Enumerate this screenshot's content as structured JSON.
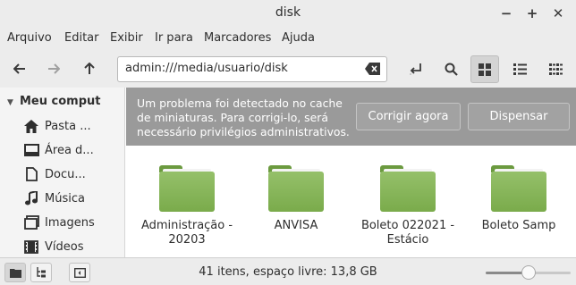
{
  "window": {
    "title": "disk"
  },
  "menubar": [
    "Arquivo",
    "Editar",
    "Exibir",
    "Ir para",
    "Marcadores",
    "Ajuda"
  ],
  "toolbar": {
    "path": "admin:///media/usuario/disk",
    "icons": [
      "back-arrow-icon",
      "forward-arrow-icon",
      "up-arrow-icon",
      "clear-location-icon",
      "toggle-location-icon",
      "search-icon",
      "icon-view-icon",
      "list-view-icon",
      "compact-view-icon"
    ],
    "active_view": "icon-view"
  },
  "sidebar": {
    "header": "Meu comput",
    "items": [
      {
        "label": "Pasta ...",
        "icon": "home-icon"
      },
      {
        "label": "Área d...",
        "icon": "desktop-icon"
      },
      {
        "label": "Docu...",
        "icon": "documents-icon"
      },
      {
        "label": "Música",
        "icon": "music-icon"
      },
      {
        "label": "Imagens",
        "icon": "pictures-icon"
      },
      {
        "label": "Vídeos",
        "icon": "videos-icon"
      }
    ]
  },
  "infobar": {
    "message": "Um problema foi detectado no cache de miniaturas. Para corrigi-lo, será necessário privilégios administrativos.",
    "fix_button": "Corrigir agora",
    "dismiss_button": "Dispensar"
  },
  "files": [
    {
      "name": "Administração - 20203",
      "icon": "folder-icon"
    },
    {
      "name": "ANVISA",
      "icon": "folder-icon"
    },
    {
      "name": "Boleto 022021 - Estácio",
      "icon": "folder-icon"
    },
    {
      "name": "Boleto Samp",
      "icon": "folder-icon"
    }
  ],
  "statusbar": {
    "text": "41 itens, espaço livre: 13,8 GB",
    "zoom_level": 0.5
  },
  "colors": {
    "folder": "#7aab4b",
    "infobar": "#9a9a9a"
  }
}
